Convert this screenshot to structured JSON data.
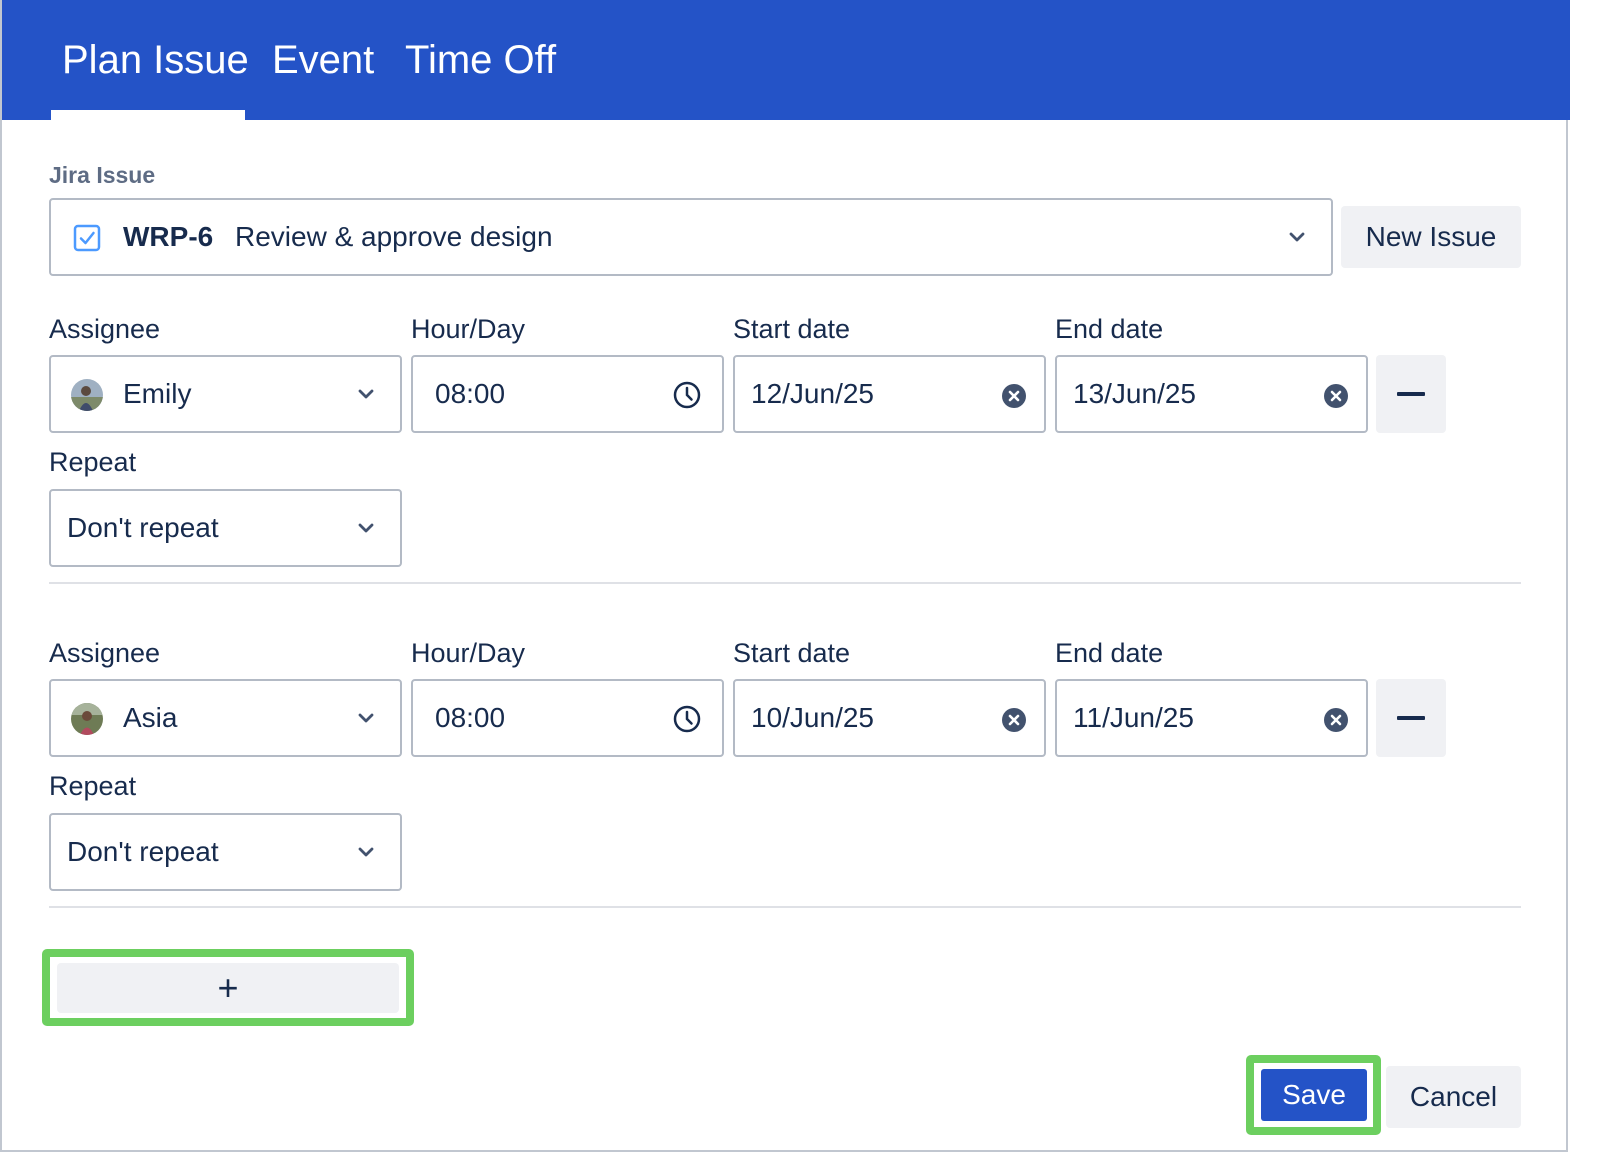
{
  "tabs": [
    {
      "label": "Plan Issue",
      "active": true
    },
    {
      "label": "Event",
      "active": false
    },
    {
      "label": "Time Off",
      "active": false
    }
  ],
  "issue": {
    "field_label": "Jira Issue",
    "key": "WRP-6",
    "summary": "Review & approve design",
    "icon": "checkbox-icon",
    "new_issue_label": "New Issue"
  },
  "rows": [
    {
      "assignee_label": "Assignee",
      "assignee": "Emily",
      "hours_label": "Hour/Day",
      "hours": "08:00",
      "start_label": "Start date",
      "start": "12/Jun/25",
      "end_label": "End date",
      "end": "13/Jun/25",
      "repeat_label": "Repeat",
      "repeat": "Don't repeat"
    },
    {
      "assignee_label": "Assignee",
      "assignee": "Asia",
      "hours_label": "Hour/Day",
      "hours": "08:00",
      "start_label": "Start date",
      "start": "10/Jun/25",
      "end_label": "End date",
      "end": "11/Jun/25",
      "repeat_label": "Repeat",
      "repeat": "Don't repeat"
    }
  ],
  "add_row_label": "+",
  "footer": {
    "save_label": "Save",
    "cancel_label": "Cancel"
  },
  "colors": {
    "header": "#2453c7",
    "primary_button": "#2453c7",
    "highlight": "#6ccf5f"
  }
}
